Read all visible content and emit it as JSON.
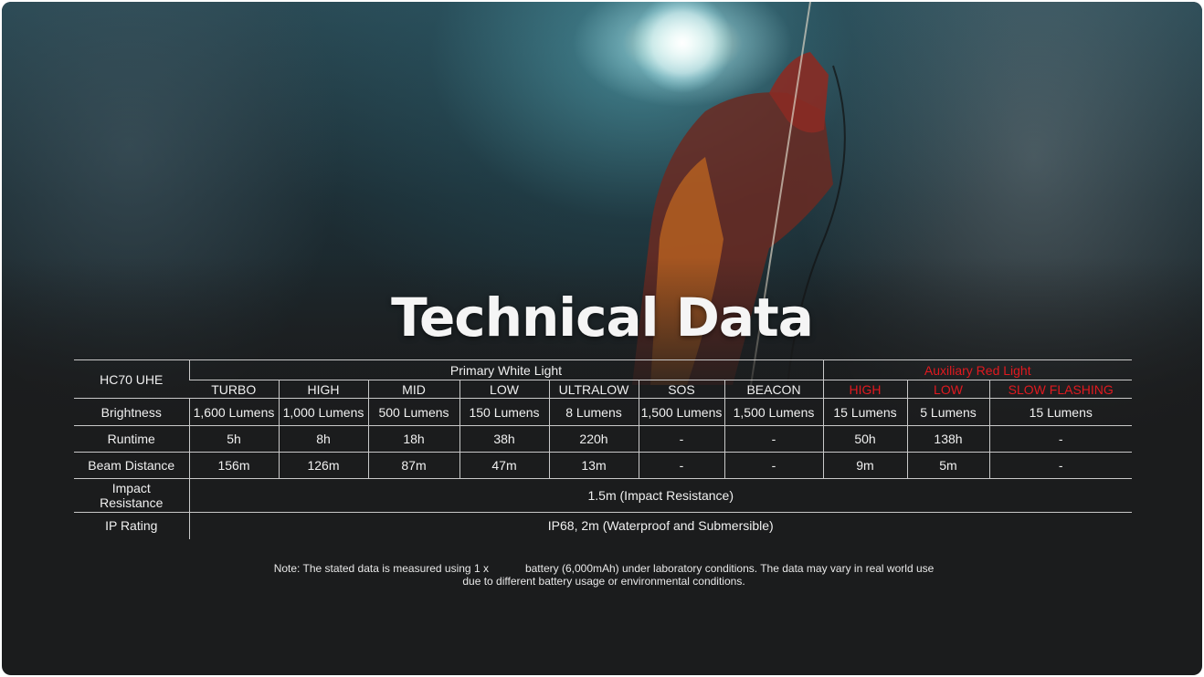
{
  "title": "Technical Data",
  "table": {
    "model": "HC70 UHE",
    "group_primary": "Primary White Light",
    "group_aux": "Auxiliary Red Light",
    "modes": [
      "TURBO",
      "HIGH",
      "MID",
      "LOW",
      "ULTRALOW",
      "SOS",
      "BEACON"
    ],
    "aux_modes": [
      "HIGH",
      "LOW",
      "SLOW FLASHING"
    ],
    "rows": [
      {
        "label": "Brightness",
        "values": [
          "1,600 Lumens",
          "1,000 Lumens",
          "500 Lumens",
          "150 Lumens",
          "8 Lumens",
          "1,500 Lumens",
          "1,500 Lumens",
          "15 Lumens",
          "5 Lumens",
          "15 Lumens"
        ]
      },
      {
        "label": "Runtime",
        "values": [
          "5h",
          "8h",
          "18h",
          "38h",
          "220h",
          "-",
          "-",
          "50h",
          "138h",
          "-"
        ]
      },
      {
        "label": "Beam Distance",
        "values": [
          "156m",
          "126m",
          "87m",
          "47m",
          "13m",
          "-",
          "-",
          "9m",
          "5m",
          "-"
        ]
      }
    ],
    "impact_label_line1": "Impact",
    "impact_label_line2": "Resistance",
    "impact_value": "1.5m (Impact Resistance)",
    "ip_label": "IP Rating",
    "ip_value": "IP68, 2m (Waterproof and Submersible)"
  },
  "note": {
    "part1": "Note: The stated data is measured using 1 x",
    "part2": "battery (6,000mAh) under laboratory conditions. The data may vary in real world use",
    "line2": "due to different battery usage or environmental conditions."
  },
  "colors": {
    "accent_red": "#e0191f",
    "background": "#1b1c1d",
    "text": "#f0f0f0"
  }
}
